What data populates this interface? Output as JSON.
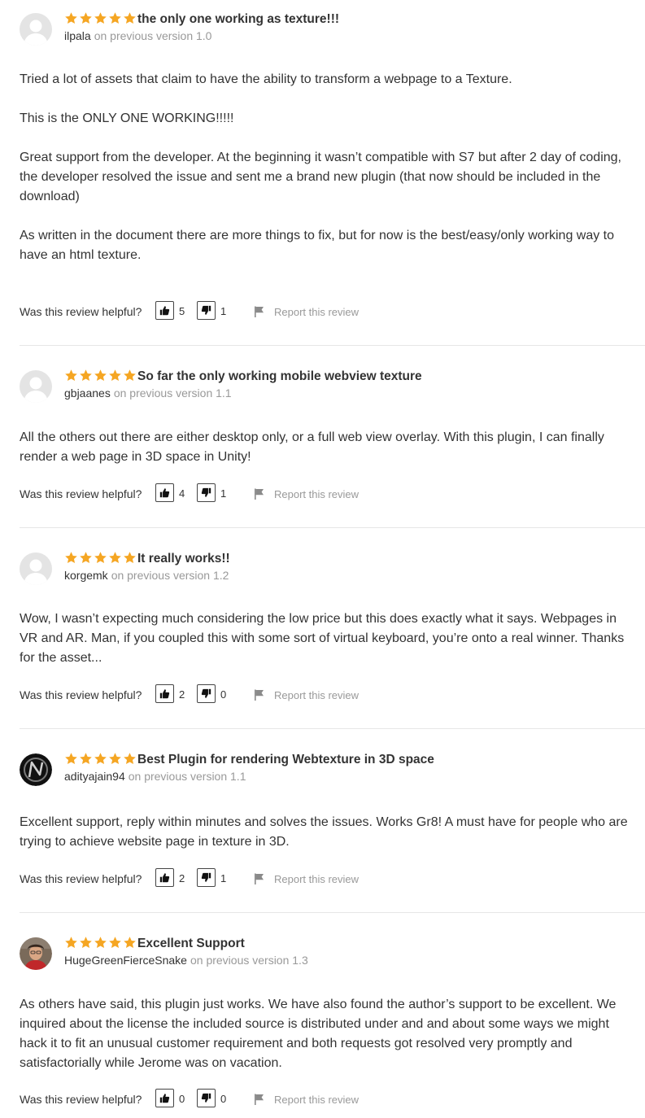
{
  "helpful_label": "Was this review helpful?",
  "report_label": "Report this review",
  "colors": {
    "star": "#f5a623",
    "text": "#333333",
    "muted": "#999999",
    "divider": "#e6e6e6"
  },
  "reviews": [
    {
      "rating": 5,
      "title": "the only one working as texture!!!",
      "user": "ilpala",
      "version": "on previous version 1.0",
      "avatar": "default",
      "paragraphs": [
        "Tried a lot of assets that claim to have the ability to transform a webpage to a Texture.",
        "This is the ONLY ONE WORKING!!!!!",
        "Great support from the developer. At the beginning it wasn’t compatible with S7 but after 2 day of coding, the developer resolved the issue and sent me a brand new plugin (that now should be included in the download)",
        "As written in the document there are more things to fix, but for now is the best/easy/only working way to have an html texture."
      ],
      "up": "5",
      "down": "1"
    },
    {
      "rating": 5,
      "title": "So far the only working mobile webview texture",
      "user": "gbjaanes",
      "version": "on previous version 1.1",
      "avatar": "default",
      "paragraphs": [
        "All the others out there are either desktop only, or a full web view overlay. With this plugin, I can finally render a web page in 3D space in Unity!"
      ],
      "up": "4",
      "down": "1"
    },
    {
      "rating": 5,
      "title": "It really works!!",
      "user": "korgemk",
      "version": "on previous version 1.2",
      "avatar": "default",
      "paragraphs": [
        "Wow, I wasn’t expecting much considering the low price but this does exactly what it says. Webpages in VR and AR. Man, if you coupled this with some sort of virtual keyboard, you’re onto a real winner. Thanks for the asset..."
      ],
      "up": "2",
      "down": "0"
    },
    {
      "rating": 5,
      "title": "Best Plugin for rendering Webtexture in 3D space",
      "user": "adityajain94",
      "version": "on previous version 1.1",
      "avatar": "logo",
      "paragraphs": [
        "Excellent support, reply within minutes and solves the issues. Works Gr8! A must have for people who are trying to achieve website page in texture in 3D."
      ],
      "up": "2",
      "down": "1"
    },
    {
      "rating": 5,
      "title": "Excellent Support",
      "user": "HugeGreenFierceSnake",
      "version": "on previous version 1.3",
      "avatar": "photo",
      "paragraphs": [
        "As others have said, this plugin just works.  We have also found the author’s support to be excellent.  We inquired about the license the included source is distributed under and and about some ways we might hack it to fit an unusual customer requirement and both requests got resolved very promptly and satisfactorially while Jerome was on vacation."
      ],
      "up": "0",
      "down": "0"
    }
  ]
}
